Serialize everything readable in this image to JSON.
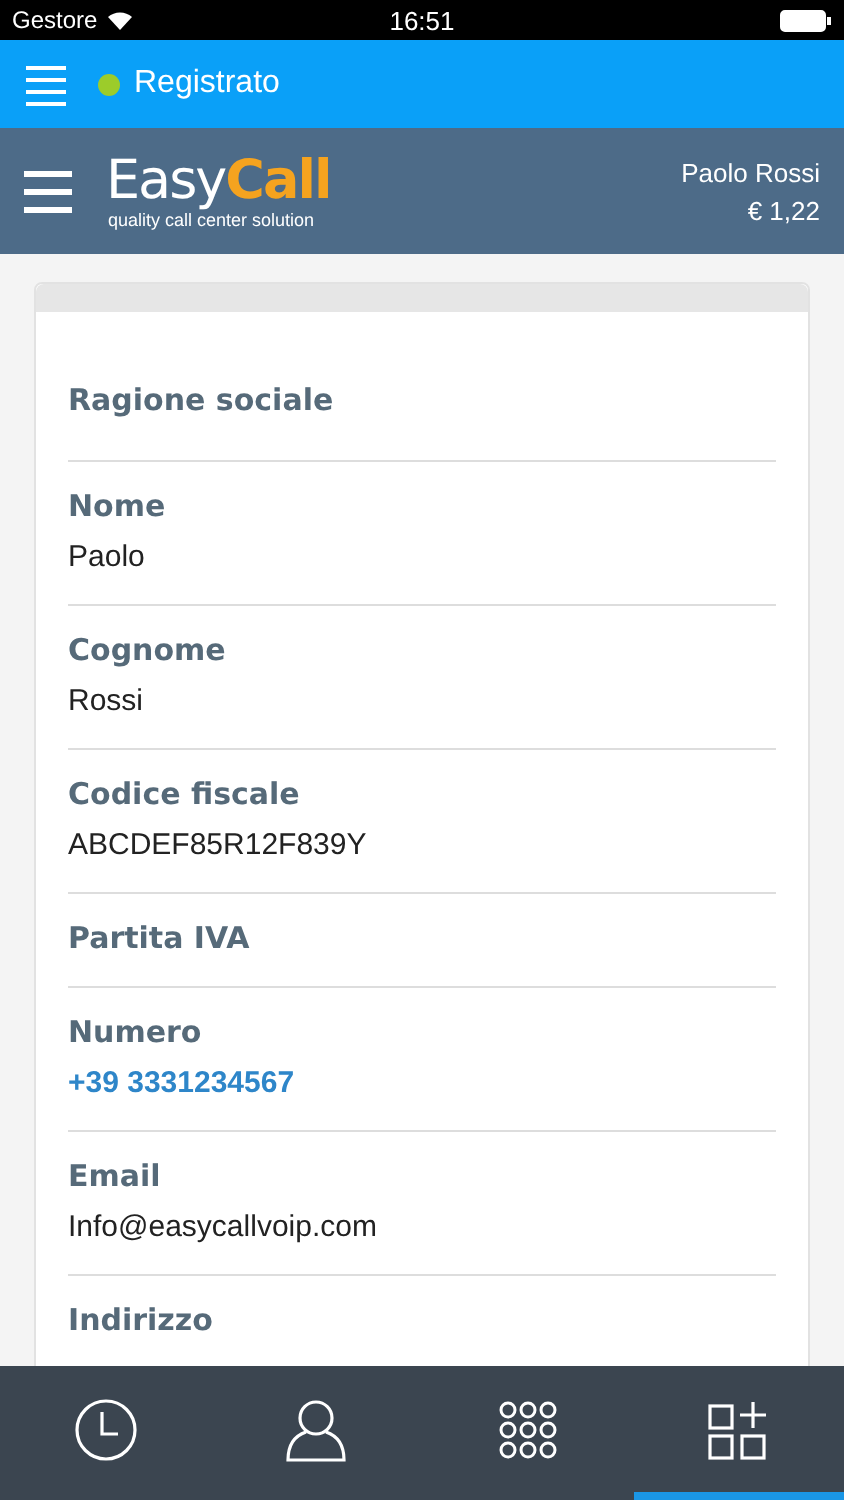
{
  "status_bar": {
    "carrier": "Gestore",
    "time": "16:51"
  },
  "top_bar": {
    "status": "Registrato",
    "color": "#9ccc2a"
  },
  "header": {
    "logo_first": "Easy",
    "logo_second": "Call",
    "tagline": "quality call center solution",
    "user": "Paolo Rossi",
    "balance": "€  1,22"
  },
  "fields": [
    {
      "label": "Ragione sociale"
    },
    {
      "label": "Nome",
      "value": "Paolo",
      "kind": "text"
    },
    {
      "label": "Cognome",
      "value": "Rossi",
      "kind": "text"
    },
    {
      "label": "Codice fiscale",
      "value": "ABCDEF85R12F839Y",
      "kind": "text"
    },
    {
      "label": "Partita IVA"
    },
    {
      "label": "Numero",
      "value": "+39 3331234567",
      "kind": "link"
    },
    {
      "label": "Email",
      "value": "Info@easycallvoip.com",
      "kind": "text"
    },
    {
      "label": "Indirizzo"
    }
  ],
  "tabs": [
    {
      "kind": "history",
      "selected": false
    },
    {
      "kind": "contact",
      "selected": false
    },
    {
      "kind": "keypad",
      "selected": false
    },
    {
      "kind": "apps",
      "selected": true
    }
  ]
}
